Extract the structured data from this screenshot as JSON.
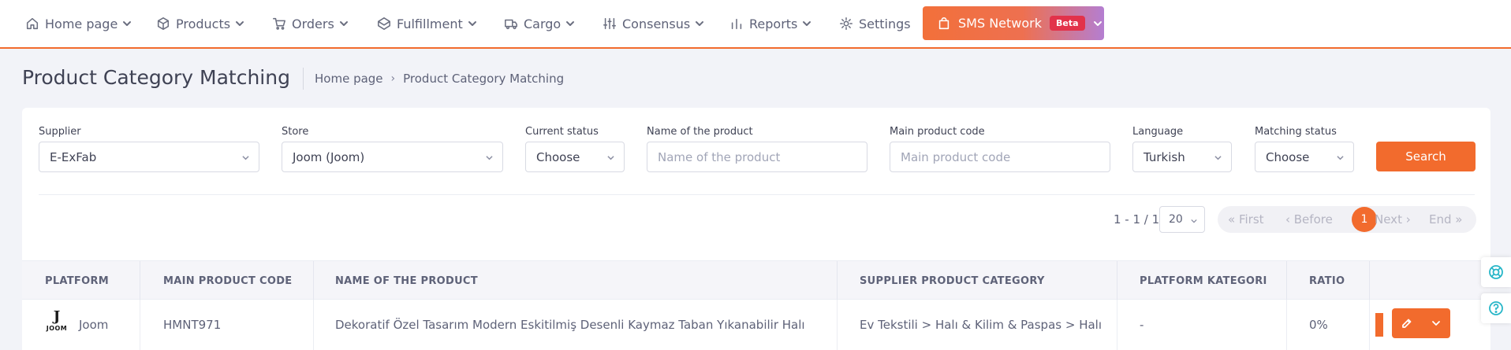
{
  "nav": {
    "items": [
      {
        "label": "Home page",
        "icon": "home-icon"
      },
      {
        "label": "Products",
        "icon": "box-icon"
      },
      {
        "label": "Orders",
        "icon": "cart-icon"
      },
      {
        "label": "Fulfillment",
        "icon": "package-icon"
      },
      {
        "label": "Cargo",
        "icon": "truck-icon"
      },
      {
        "label": "Consensus",
        "icon": "sliders-icon"
      },
      {
        "label": "Reports",
        "icon": "bar-chart-icon"
      },
      {
        "label": "Settings",
        "icon": "gear-icon"
      }
    ],
    "sms": {
      "label": "SMS Network",
      "badge": "Beta"
    }
  },
  "header": {
    "title": "Product Category Matching",
    "breadcrumb": [
      "Home page",
      "Product Category Matching"
    ]
  },
  "filters": {
    "supplier": {
      "label": "Supplier",
      "value": "E-ExFab"
    },
    "store": {
      "label": "Store",
      "value": "Joom (Joom)"
    },
    "current_status": {
      "label": "Current status",
      "value": "Choose"
    },
    "product_name": {
      "label": "Name of the product",
      "placeholder": "Name of the product"
    },
    "main_code": {
      "label": "Main product code",
      "placeholder": "Main product code"
    },
    "language": {
      "label": "Language",
      "value": "Turkish"
    },
    "matching_status": {
      "label": "Matching status",
      "value": "Choose"
    },
    "search_label": "Search"
  },
  "pagination": {
    "range": "1 - 1 / 1",
    "page_size": "20",
    "first": "« First",
    "before": "‹ Before",
    "current": "1",
    "next": "Next ›",
    "end": "End »"
  },
  "table": {
    "columns": [
      "PLATFORM",
      "MAIN PRODUCT CODE",
      "NAME OF THE PRODUCT",
      "SUPPLIER PRODUCT CATEGORY",
      "PLATFORM KATEGORI",
      "RATIO"
    ],
    "rows": [
      {
        "platform": "Joom",
        "logo_letter": "J",
        "logo_text": "JOOM",
        "main_code": "HMNT971",
        "name": "Dekoratif Özel Tasarım Modern Eskitilmiş Desenli Kaymaz Taban Yıkanabilir Halı",
        "supplier_category": "Ev Tekstili > Halı & Kilim & Paspas > Halı",
        "platform_category": "-",
        "ratio": "0%"
      }
    ]
  },
  "colors": {
    "accent": "#f26b2d",
    "help": "#27b6c8"
  }
}
